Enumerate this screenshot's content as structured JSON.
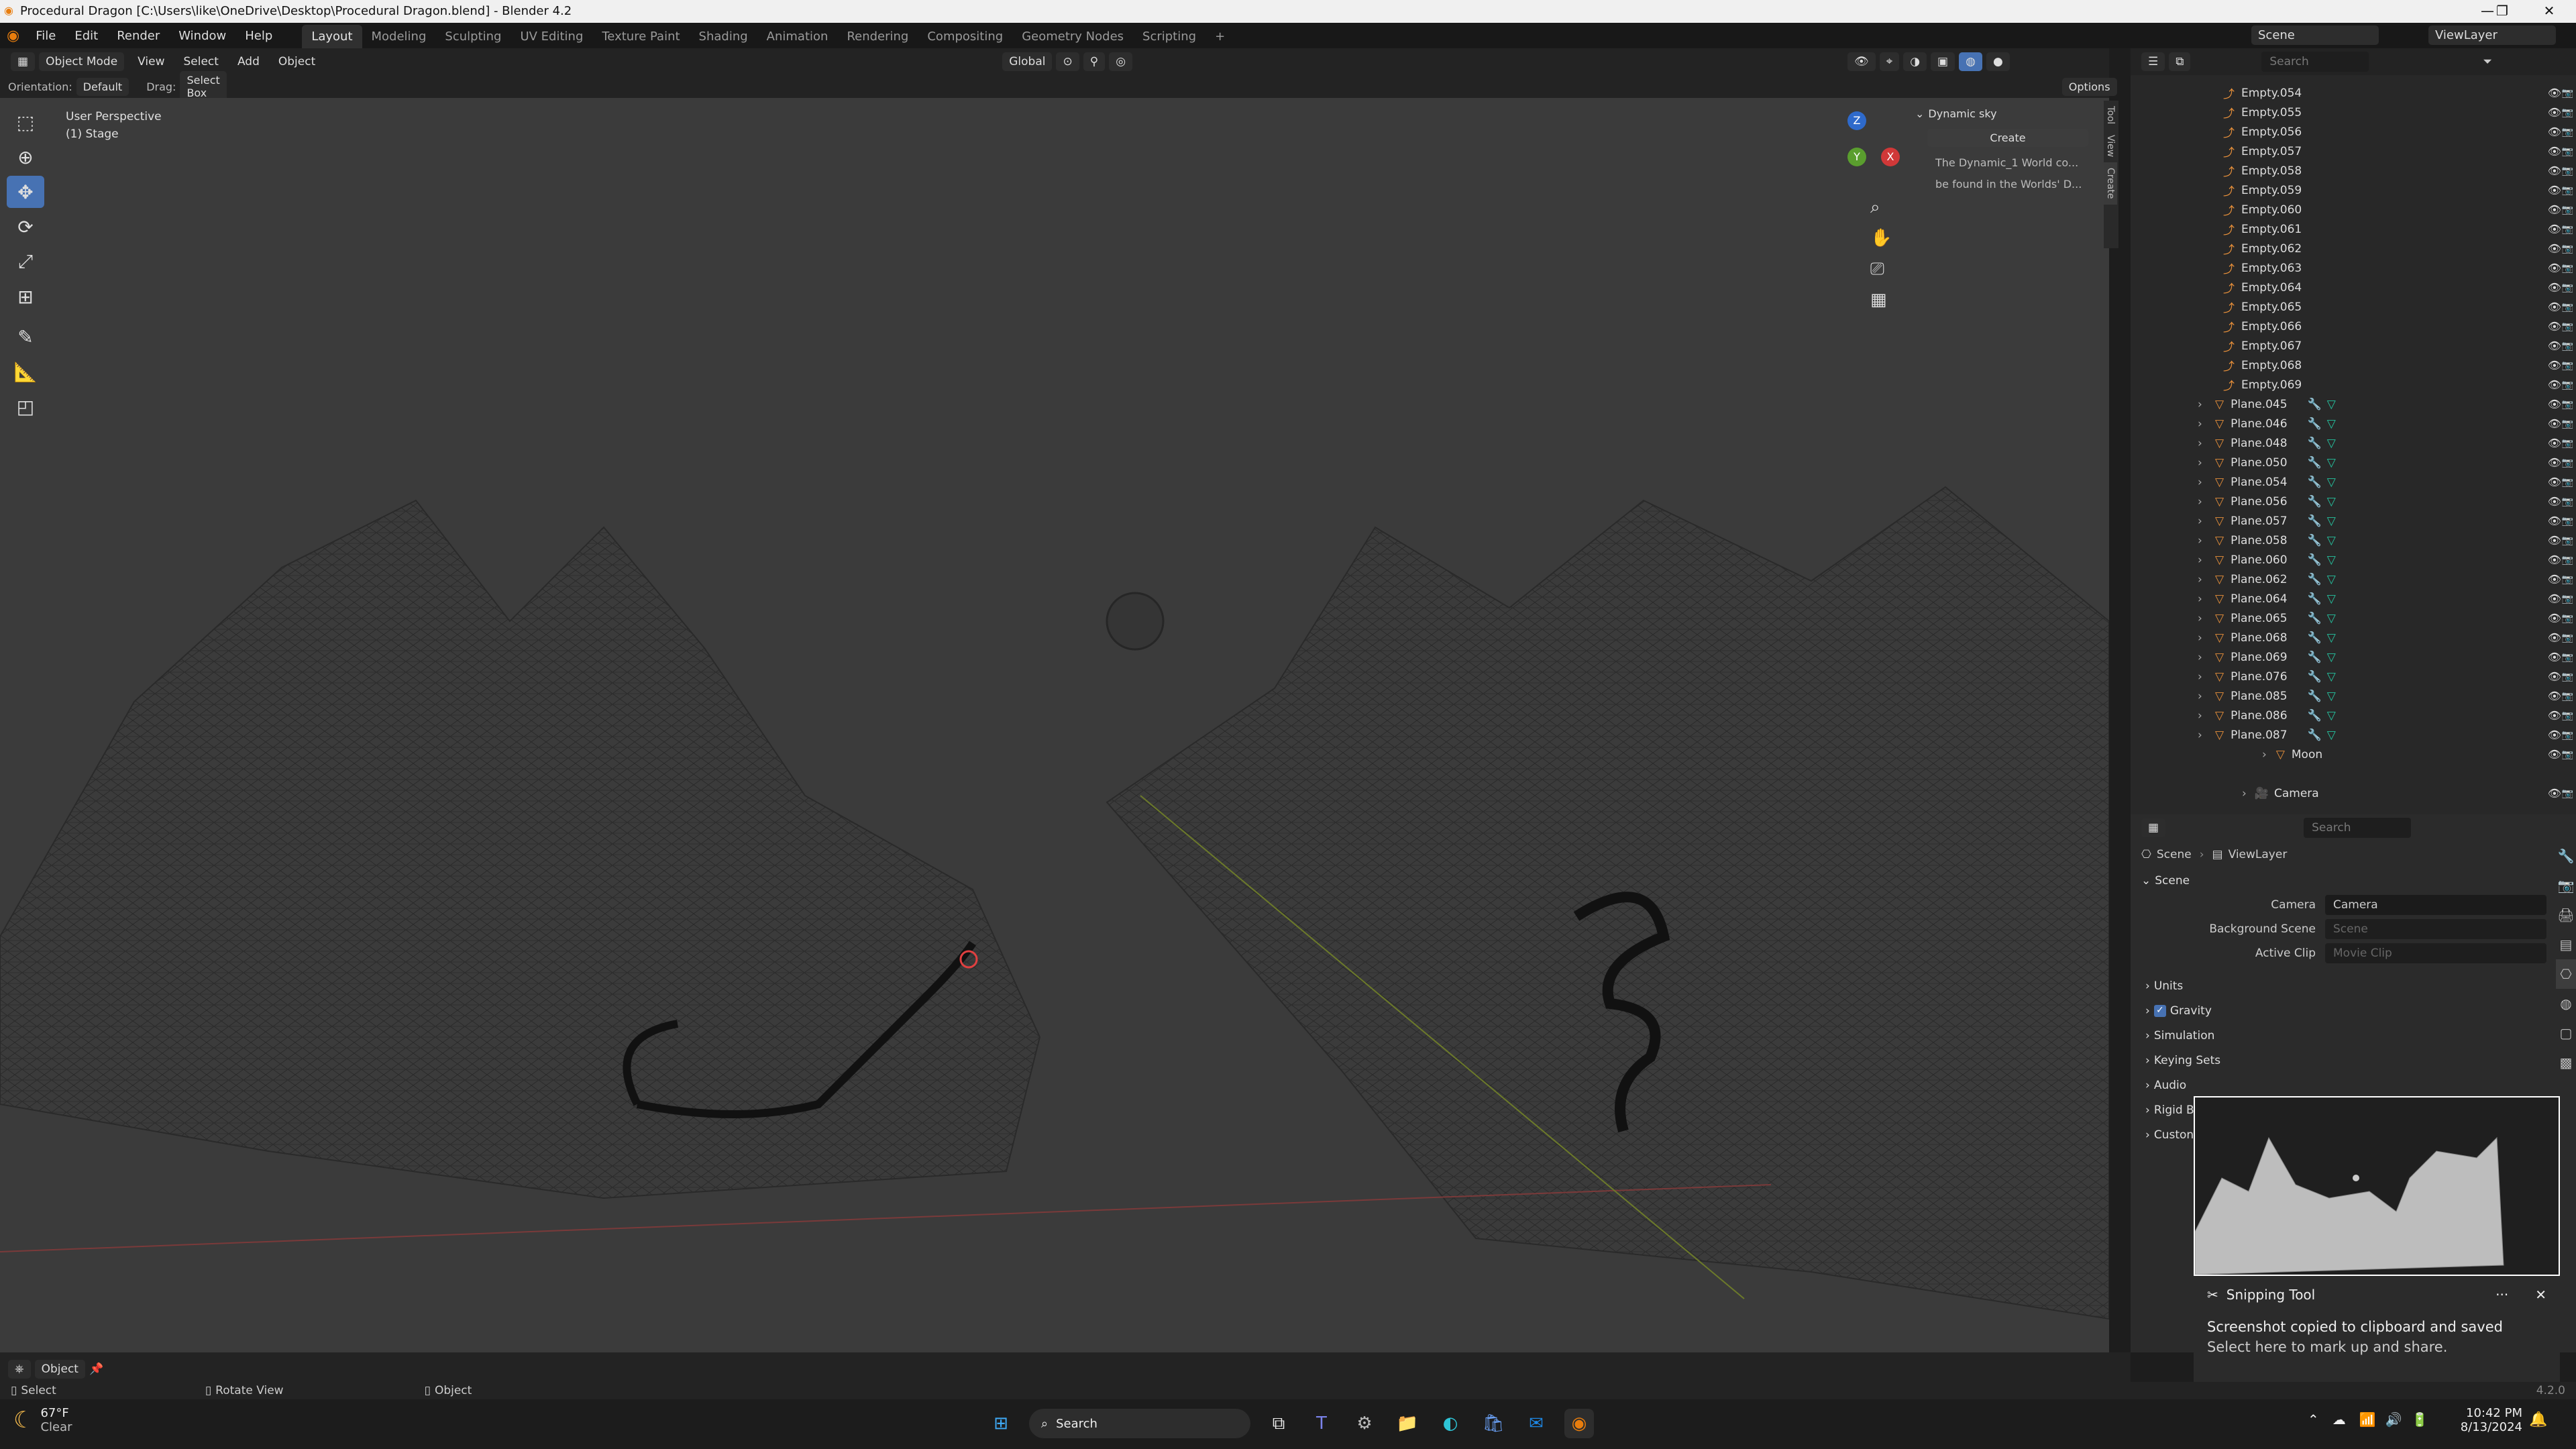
{
  "window": {
    "title": "Procedural Dragon [C:\\Users\\like\\OneDrive\\Desktop\\Procedural Dragon.blend] - Blender 4.2"
  },
  "menubar": {
    "items": [
      "File",
      "Edit",
      "Render",
      "Window",
      "Help"
    ],
    "workspaces": [
      "Layout",
      "Modeling",
      "Sculpting",
      "UV Editing",
      "Texture Paint",
      "Shading",
      "Animation",
      "Rendering",
      "Compositing",
      "Geometry Nodes",
      "Scripting"
    ],
    "active_workspace": "Layout",
    "scene_label": "Scene",
    "viewlayer_label": "ViewLayer"
  },
  "viewport_header": {
    "mode": "Object Mode",
    "menus": [
      "View",
      "Select",
      "Add",
      "Object"
    ],
    "transform": "Global",
    "options": "Options",
    "orientation_label": "Orientation:",
    "orientation_value": "Default",
    "drag_label": "Drag:",
    "drag_value": "Select Box"
  },
  "viewport": {
    "perspective": "User Perspective",
    "collection": "(1) Stage",
    "gizmo_labels": [
      "Z",
      "Y",
      "X"
    ]
  },
  "npanel": {
    "title": "Dynamic sky",
    "create_button": "Create",
    "info_line1": "The Dynamic_1 World co...",
    "info_line2": "be found in the Worlds' D...",
    "tabs": [
      "Tool",
      "View",
      "Create"
    ]
  },
  "outliner": {
    "search_placeholder": "Search",
    "empties": [
      "Empty.054",
      "Empty.055",
      "Empty.056",
      "Empty.057",
      "Empty.058",
      "Empty.059",
      "Empty.060",
      "Empty.061",
      "Empty.062",
      "Empty.063",
      "Empty.064",
      "Empty.065",
      "Empty.066",
      "Empty.067",
      "Empty.068",
      "Empty.069"
    ],
    "planes": [
      "Plane.045",
      "Plane.046",
      "Plane.048",
      "Plane.050",
      "Plane.054",
      "Plane.056",
      "Plane.057",
      "Plane.058",
      "Plane.060",
      "Plane.062",
      "Plane.064",
      "Plane.065",
      "Plane.068",
      "Plane.069",
      "Plane.076",
      "Plane.085",
      "Plane.086",
      "Plane.087"
    ],
    "moon": "Moon",
    "camera": "Camera"
  },
  "properties": {
    "search_placeholder": "Search",
    "breadcrumb_scene": "Scene",
    "breadcrumb_viewlayer": "ViewLayer",
    "section_scene": "Scene",
    "camera_label": "Camera",
    "camera_value": "Camera",
    "bg_label": "Background Scene",
    "bg_placeholder": "Scene",
    "clip_label": "Active Clip",
    "clip_placeholder": "Movie Clip",
    "sections": [
      "Units",
      "Gravity",
      "Simulation",
      "Keying Sets",
      "Audio",
      "Rigid B",
      "Custon"
    ]
  },
  "toast": {
    "app": "Snipping Tool",
    "line1": "Screenshot copied to clipboard and saved",
    "line2": "Select here to mark up and share.",
    "more": "···",
    "close": "✕"
  },
  "statusbar": {
    "select": "Select",
    "rotate": "Rotate View",
    "object": "Object",
    "mode": "Object",
    "version": "4.2.0"
  },
  "taskbar": {
    "weather_temp": "67°F",
    "weather_desc": "Clear",
    "search": "Search",
    "time": "10:42 PM",
    "date": "8/13/2024"
  }
}
